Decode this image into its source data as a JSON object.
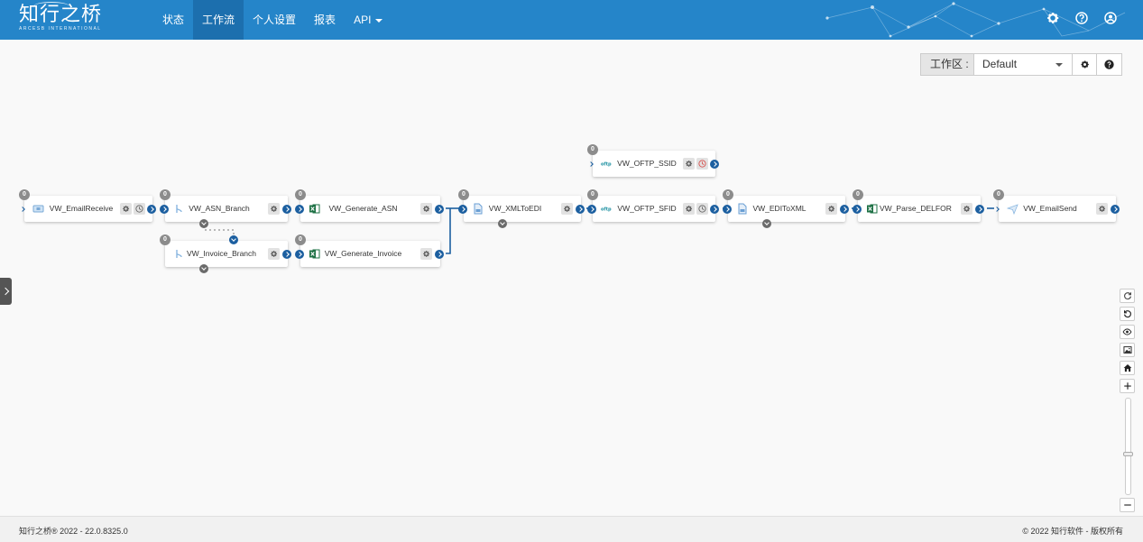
{
  "brand": {
    "name": "知行之桥",
    "tagline": "ARCESB INTERNATIONAL"
  },
  "nav": {
    "items": [
      {
        "label": "状态",
        "active": false
      },
      {
        "label": "工作流",
        "active": true
      },
      {
        "label": "个人设置",
        "active": false
      },
      {
        "label": "报表",
        "active": false
      },
      {
        "label": "API",
        "active": false,
        "dropdown": true
      }
    ]
  },
  "top_icons": [
    "settings-icon",
    "help-icon",
    "user-icon"
  ],
  "workspace": {
    "label": "工作区 :",
    "selected": "Default"
  },
  "nodes": [
    {
      "label": "VW_EmailReceive",
      "badge": "0",
      "type": "email-receive-icon",
      "schedule": true
    },
    {
      "label": "VW_ASN_Branch",
      "badge": "0",
      "type": "branch-icon"
    },
    {
      "label": "VW_Invoice_Branch",
      "badge": "0",
      "type": "branch-icon"
    },
    {
      "label": "VW_Generate_ASN",
      "badge": "0",
      "type": "excel-icon"
    },
    {
      "label": "VW_Generate_Invoice",
      "badge": "0",
      "type": "excel-icon"
    },
    {
      "label": "VW_XMLToEDI",
      "badge": "0",
      "type": "x12-icon"
    },
    {
      "label": "VW_OFTP_SSID",
      "badge": "0",
      "type": "oftp-icon",
      "schedule": true,
      "schedule_alert": true
    },
    {
      "label": "VW_OFTP_SFID",
      "badge": "0",
      "type": "oftp-icon",
      "schedule": true
    },
    {
      "label": "VW_EDIToXML",
      "badge": "0",
      "type": "x12-icon"
    },
    {
      "label": "VW_Parse_DELFOR",
      "badge": "0",
      "type": "excel-icon"
    },
    {
      "label": "VW_EmailSend",
      "badge": "0",
      "type": "email-send-icon"
    }
  ],
  "zoom": {
    "level_fraction": 0.58
  },
  "right_tools": [
    "redo-icon",
    "undo-icon",
    "eye-icon",
    "image-icon",
    "home-icon",
    "zoom-in-icon"
  ],
  "footer": {
    "left": "知行之桥® 2022 - 22.0.8325.0",
    "right": "© 2022 知行软件 - 版权所有"
  },
  "colors": {
    "navbar": "#2585c9",
    "nav_active": "#1c6fae",
    "port": "#1c5fa0",
    "badge": "#8c8c8c"
  }
}
